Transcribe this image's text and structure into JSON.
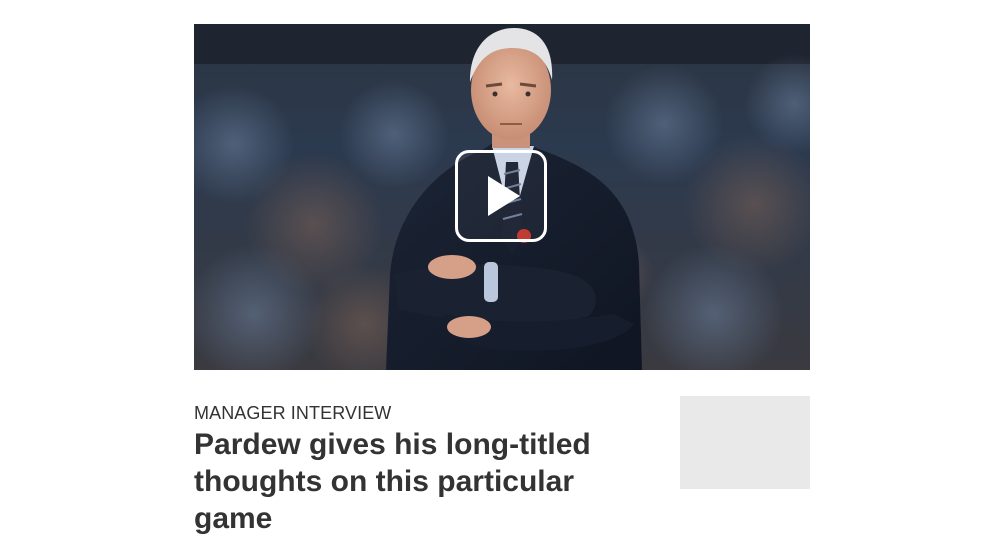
{
  "article": {
    "category": "MANAGER INTERVIEW",
    "headline": "Pardew gives his long-titled thoughts on this particular game"
  },
  "media": {
    "type": "video",
    "play_icon": "play-icon",
    "subject": "manager-photo"
  },
  "colors": {
    "text": "#333333",
    "placeholder": "#e9e9e9",
    "play_outline": "#ffffff"
  }
}
